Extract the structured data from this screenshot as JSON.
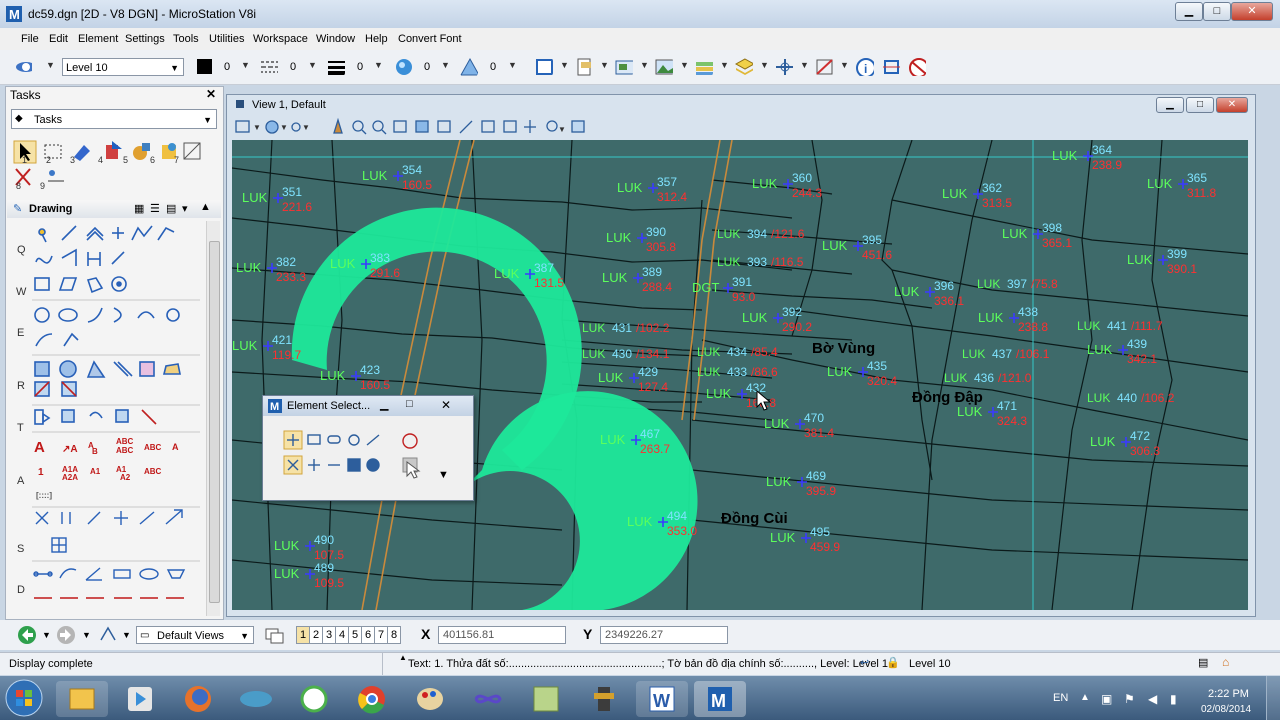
{
  "window": {
    "title": "dc59.dgn [2D - V8 DGN] - MicroStation V8i",
    "minimize": "▁",
    "maximize": "□",
    "close": "✕"
  },
  "menu": [
    "File",
    "Edit",
    "Element",
    "Settings",
    "Tools",
    "Utilities",
    "Workspace",
    "Window",
    "Help",
    "Convert Font"
  ],
  "attributes": {
    "level": "Level 10",
    "color_value": "0",
    "style_value": "0",
    "weight_value": "0",
    "transparency_value": "0",
    "priority_value": "0"
  },
  "tasks": {
    "title": "Tasks",
    "close": "✕",
    "dropdown": "Tasks",
    "section": "Drawing",
    "row_letters": [
      "Q",
      "W",
      "E",
      "R",
      "T",
      "A",
      "S",
      "D"
    ],
    "quick_numbers": [
      "1",
      "2",
      "3",
      "4",
      "5",
      "6",
      "7",
      "8",
      "9"
    ]
  },
  "view": {
    "title": "View 1, Default"
  },
  "element_select": {
    "title": "Element Select..."
  },
  "map": {
    "places": [
      "Bờ Vùng",
      "Đồng Đập",
      "Đồng Cùi"
    ],
    "parcels": [
      {
        "code": "LUK",
        "id": "351",
        "area": "221.6"
      },
      {
        "code": "LUK",
        "id": "354",
        "area": "160.5"
      },
      {
        "code": "LUK",
        "id": "357",
        "area": "312.4"
      },
      {
        "code": "LUK",
        "id": "360",
        "area": "244.3"
      },
      {
        "code": "LUK",
        "id": "362",
        "area": "313.5"
      },
      {
        "code": "LUK",
        "id": "364",
        "area": "238.9"
      },
      {
        "code": "LUK",
        "id": "365",
        "area": "311.8"
      },
      {
        "code": "LUK",
        "id": "382",
        "area": "233.3"
      },
      {
        "code": "LUK",
        "id": "383",
        "area": "291.6"
      },
      {
        "code": "LUK",
        "id": "387",
        "area": "131.5"
      },
      {
        "code": "LUK",
        "id": "390",
        "area": "305.8"
      },
      {
        "code": "LUK",
        "id": "389",
        "area": "288.4"
      },
      {
        "code": "LUK",
        "id": "395",
        "area": "451.6"
      },
      {
        "code": "LUK",
        "id": "398",
        "area": "365.1"
      },
      {
        "code": "LUK",
        "id": "399",
        "area": "390.1"
      },
      {
        "code": "LUK",
        "id": "396",
        "area": "336.1"
      },
      {
        "code": "DGT",
        "id": "391",
        "area": "93.0"
      },
      {
        "code": "LUK",
        "id": "392",
        "area": "290.2"
      },
      {
        "code": "LUK",
        "id": "438",
        "area": "238.8"
      },
      {
        "code": "LUK",
        "id": "439",
        "area": "342.1"
      },
      {
        "code": "LUK",
        "id": "435",
        "area": "320.4"
      },
      {
        "code": "LUK",
        "id": "429",
        "area": "127.4"
      },
      {
        "code": "LUK",
        "id": "432",
        "area": "168.8"
      },
      {
        "code": "LUK",
        "id": "471",
        "area": "324.3"
      },
      {
        "code": "LUK",
        "id": "472",
        "area": "306.3"
      },
      {
        "code": "LUK",
        "id": "470",
        "area": "381.4"
      },
      {
        "code": "LUK",
        "id": "467",
        "area": "263.7"
      },
      {
        "code": "LUK",
        "id": "469",
        "area": "395.9"
      },
      {
        "code": "LUK",
        "id": "494",
        "area": "353.0"
      },
      {
        "code": "LUK",
        "id": "495",
        "area": "459.9"
      },
      {
        "code": "LUK",
        "id": "490",
        "area": "107.5"
      },
      {
        "code": "LUK",
        "id": "489",
        "area": "109.5"
      },
      {
        "code": "LUK",
        "id": "421",
        "area": "119.7"
      },
      {
        "code": "LUK",
        "id": "423",
        "area": "160.5"
      }
    ],
    "slash_parcels": [
      {
        "code": "LUK",
        "id": "394",
        "area": "121.6"
      },
      {
        "code": "LUK",
        "id": "393",
        "area": "116.5"
      },
      {
        "code": "LUK",
        "id": "397",
        "area": "75.8"
      },
      {
        "code": "LUK",
        "id": "441",
        "area": "111.7"
      },
      {
        "code": "LUK",
        "id": "431",
        "area": "102.2"
      },
      {
        "code": "LUK",
        "id": "430",
        "area": "134.1"
      },
      {
        "code": "LUK",
        "id": "434",
        "area": "85.4"
      },
      {
        "code": "LUK",
        "id": "433",
        "area": "86.6"
      },
      {
        "code": "LUK",
        "id": "437",
        "area": "106.1"
      },
      {
        "code": "LUK",
        "id": "436",
        "area": "121.0"
      },
      {
        "code": "LUK",
        "id": "440",
        "area": "106.2"
      }
    ]
  },
  "bottom": {
    "views": "Default Views",
    "view_numbers": [
      "1",
      "2",
      "3",
      "4",
      "5",
      "6",
      "7",
      "8"
    ],
    "x_label": "X",
    "x_value": "401156.81",
    "y_label": "Y",
    "y_value": "2349226.27"
  },
  "status": {
    "left": "Display complete",
    "prompt": "Text: 1. Thửa đất số:..................................................; Tờ bản đồ địa chính số:.........., Level: Level 1",
    "level": "Level 10"
  },
  "taskbar": {
    "lang": "EN",
    "time": "2:22 PM",
    "date": "02/08/2014"
  },
  "colors": {
    "map_bg": "#3e6a6a",
    "parcel_code": "#5cff5c",
    "parcel_area": "#ff3030",
    "parcel_id": "#7fe3ff",
    "logo": "#1de89a",
    "road": "#c98a3c"
  }
}
